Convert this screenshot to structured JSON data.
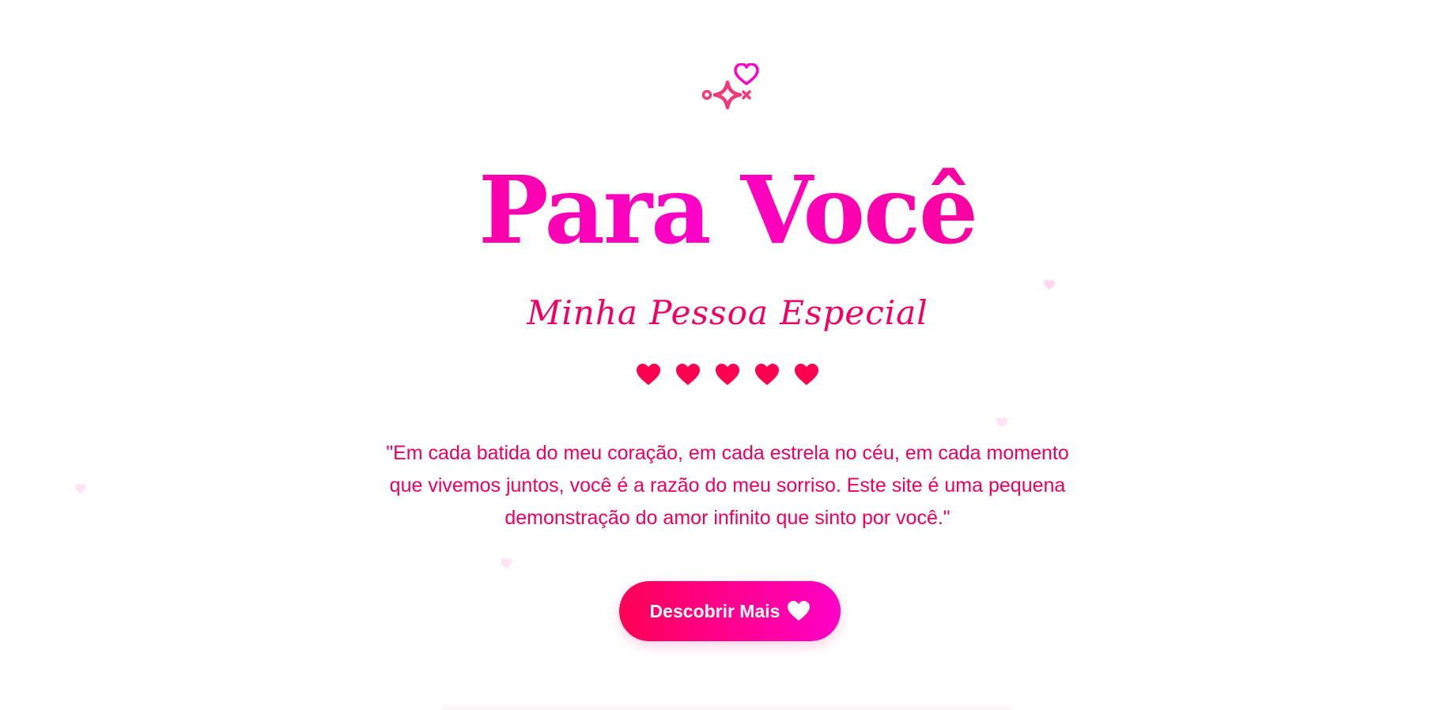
{
  "header": {
    "sparkle_icon": "sparkle-heart-icon"
  },
  "hero": {
    "title": "Para Você",
    "subtitle": "Minha Pessoa Especial",
    "hearts_icon": "heart-icon",
    "hearts_count": 5,
    "quote": "\"Em cada batida do meu coração, em cada estrela no céu, em cada momento que vivemos juntos, você é a razão do meu sorriso. Este site é uma pequena demonstração do amor infinito que sinto por você.\"",
    "button_label": "Descobrir Mais",
    "button_icon": "heart-icon"
  },
  "colors": {
    "primary": "#ff0055",
    "accent": "#ff00c8",
    "text": "#ee0060",
    "background": "#ffffff"
  },
  "decorations": {
    "floating_icon": "floating-heart-icon"
  }
}
